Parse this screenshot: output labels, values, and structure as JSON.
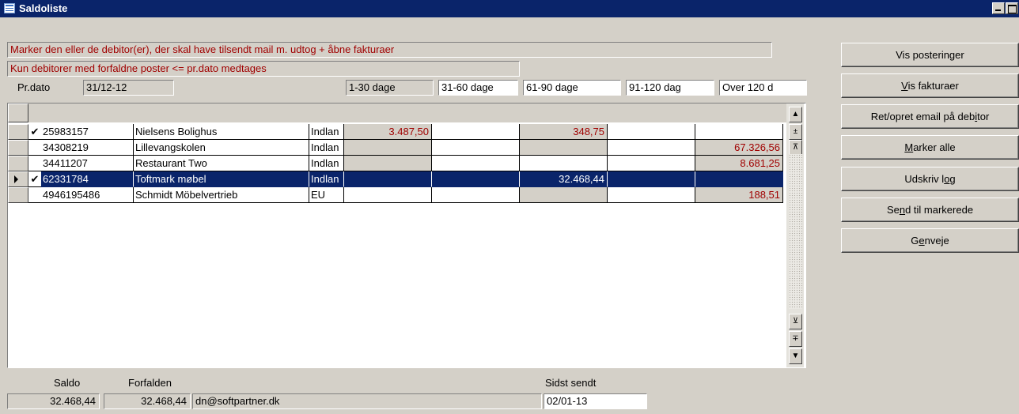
{
  "window": {
    "title": "Saldoliste",
    "icon": "list-window-icon"
  },
  "info": {
    "line1": "Marker den eller de debitor(er), der skal have tilsendt mail m. udtog + åbne fakturaer",
    "line2": "Kun debitorer med forfaldne poster <= pr.dato medtages",
    "prdato_label": "Pr.dato",
    "prdato_value": "31/12-12"
  },
  "columns": {
    "c1": "1-30 dage",
    "c2": "31-60 dage",
    "c3": "61-90 dage",
    "c4": "91-120 dag",
    "c5": "Over 120 d"
  },
  "rows": [
    {
      "checked": "✔",
      "nr": "25983157",
      "name": "Nielsens Bolighus",
      "type": "Indlan",
      "c1": "3.487,50",
      "c2": "",
      "c3": "348,75",
      "c4": "",
      "c5": ""
    },
    {
      "checked": "",
      "nr": "34308219",
      "name": "Lillevangskolen",
      "type": "Indlan",
      "c1": "",
      "c2": "",
      "c3": "",
      "c4": "",
      "c5": "67.326,56"
    },
    {
      "checked": "",
      "nr": "34411207",
      "name": "Restaurant Two",
      "type": "Indlan",
      "c1": "",
      "c2": "",
      "c3": "",
      "c4": "",
      "c5": "8.681,25"
    },
    {
      "checked": "✔",
      "nr": "62331784",
      "name": "Toftmark møbel",
      "type": "Indlan",
      "c1": "",
      "c2": "",
      "c3": "32.468,44",
      "c4": "",
      "c5": ""
    },
    {
      "checked": "",
      "nr": "4946195486",
      "name": "Schmidt Möbelvertrieb",
      "type": "EU",
      "c1": "",
      "c2": "",
      "c3": "",
      "c4": "",
      "c5": "188,51"
    }
  ],
  "buttons": {
    "vis_posteringer": "Vis posteringer",
    "vis_fakturaer_pre": "",
    "vis_fakturaer_u": "V",
    "vis_fakturaer_post": "is fakturaer",
    "ret_opret_pre": "Ret/opret email på deb",
    "ret_opret_u": "i",
    "ret_opret_post": "tor",
    "marker_pre": "",
    "marker_u": "M",
    "marker_post": "arker alle",
    "udskriv_pre": "Udskriv l",
    "udskriv_u": "o",
    "udskriv_post": "g",
    "send_pre": "Se",
    "send_u": "n",
    "send_post": "d til markerede",
    "genveje_pre": "G",
    "genveje_u": "e",
    "genveje_post": "nveje"
  },
  "footer": {
    "saldo_label": "Saldo",
    "saldo_value": "32.468,44",
    "forfalden_label": "Forfalden",
    "forfalden_value": "32.468,44",
    "email": "dn@softpartner.dk",
    "sidst_sendt_label": "Sidst sendt",
    "sidst_sendt_value": "02/01-13"
  },
  "colors": {
    "titlebar": "#0a246a",
    "selection": "#0a246a",
    "amount_text": "#a00000"
  }
}
